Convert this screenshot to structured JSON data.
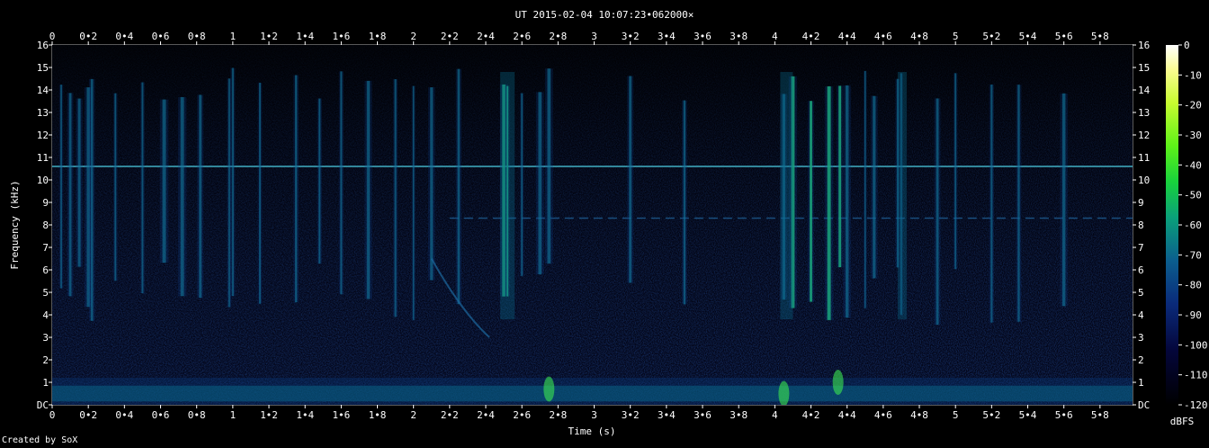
{
  "chart_data": {
    "type": "heatmap",
    "title": "UT 2015-02-04 10:07:23•062000×",
    "xlabel": "Time (s)",
    "ylabel": "Frequency (kHz)",
    "xlim": [
      0,
      5.98
    ],
    "ylim": [
      0,
      16
    ],
    "x_ticks": [
      "0",
      "0•2",
      "0•4",
      "0•6",
      "0•8",
      "1",
      "1•2",
      "1•4",
      "1•6",
      "1•8",
      "2",
      "2•2",
      "2•4",
      "2•6",
      "2•8",
      "3",
      "3•2",
      "3•4",
      "3•6",
      "3•8",
      "4",
      "4•2",
      "4•4",
      "4•6",
      "4•8",
      "5",
      "5•2",
      "5•4",
      "5•6",
      "5•8"
    ],
    "y_ticks": [
      "DC",
      "1",
      "2",
      "3",
      "4",
      "5",
      "6",
      "7",
      "8",
      "9",
      "10",
      "11",
      "12",
      "13",
      "14",
      "15",
      "16"
    ],
    "colorbar": {
      "label": "dBFS",
      "ticks": [
        "0",
        "-10",
        "-20",
        "-30",
        "-40",
        "-50",
        "-60",
        "-70",
        "-80",
        "-90",
        "-100",
        "-110",
        "-120"
      ],
      "range": [
        -120,
        0
      ]
    },
    "features": {
      "tone_khz": 10.6,
      "tone2_khz": 8.3,
      "low_band_khz": 0.5,
      "transients_s": [
        0.05,
        0.1,
        0.15,
        0.2,
        0.22,
        0.35,
        0.5,
        0.62,
        0.72,
        0.82,
        0.98,
        1.0,
        1.15,
        1.35,
        1.48,
        1.6,
        1.75,
        1.9,
        2.0,
        2.1,
        2.25,
        2.5,
        2.52,
        2.6,
        2.7,
        2.75,
        3.2,
        3.5,
        4.05,
        4.1,
        4.2,
        4.3,
        4.36,
        4.4,
        4.5,
        4.55,
        4.68,
        4.7,
        4.9,
        5.0,
        5.2,
        5.35,
        5.6
      ],
      "chirp": {
        "start_s": 2.1,
        "start_khz": 6.5,
        "end_s": 2.42,
        "end_khz": 3.0
      }
    }
  },
  "credit": "Created by SoX"
}
